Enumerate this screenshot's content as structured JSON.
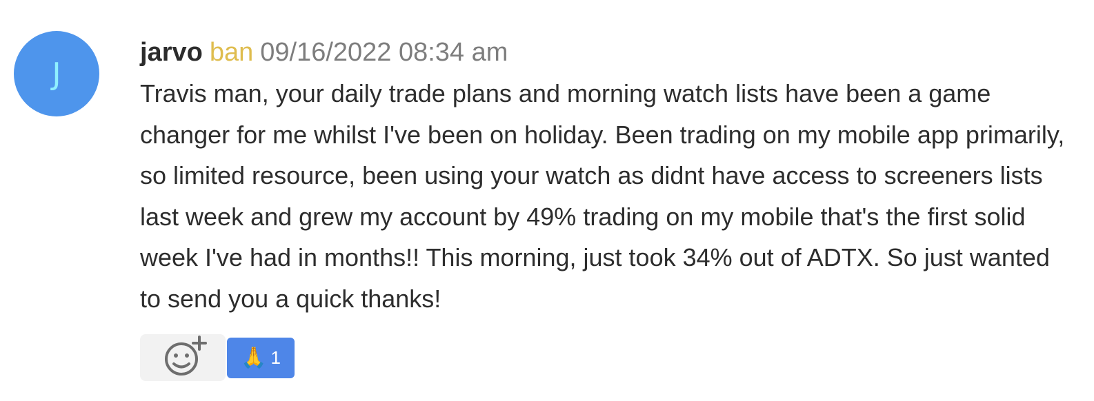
{
  "message": {
    "avatar_initial": "J",
    "username": "jarvo",
    "role": "ban",
    "timestamp": "09/16/2022 08:34 am",
    "body": "Travis man, your daily trade plans and morning watch lists have been a game changer for me whilst I've been on holiday. Been trading on my mobile app primarily, so limited resource, been using your watch as didnt have access to screeners lists last week and grew my account by 49% trading on my mobile that's the first solid week I've had in months!! This morning, just took 34% out of ADTX. So just wanted to send you a quick thanks!"
  },
  "reactions": {
    "add_icon": "add-reaction-smiley-icon",
    "items": [
      {
        "emoji": "🙏",
        "icon": "folded-hands-icon",
        "count": "1"
      }
    ]
  },
  "colors": {
    "avatar_bg": "#4e95ec",
    "avatar_text": "#8ff0ff",
    "role": "#dfbd4f",
    "timestamp": "#7d7d7d",
    "reaction_chip": "#4e86e8"
  }
}
